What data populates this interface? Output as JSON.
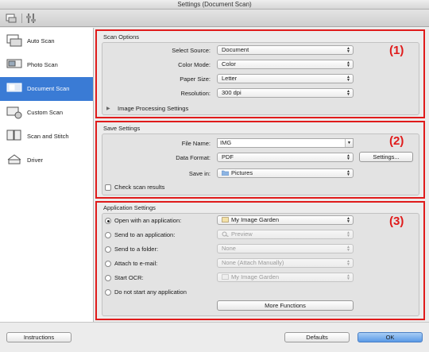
{
  "window": {
    "title": "Settings (Document Scan)"
  },
  "toolbar": {
    "icons": [
      "scan-from-computer-icon",
      "general-settings-icon"
    ]
  },
  "sidebar": {
    "items": [
      {
        "label": "Auto Scan",
        "icon": "auto-scan-icon",
        "selected": false
      },
      {
        "label": "Photo Scan",
        "icon": "photo-scan-icon",
        "selected": false
      },
      {
        "label": "Document Scan",
        "icon": "document-scan-icon",
        "selected": true
      },
      {
        "label": "Custom Scan",
        "icon": "custom-scan-icon",
        "selected": false
      },
      {
        "label": "Scan and Stitch",
        "icon": "scan-and-stitch-icon",
        "selected": false
      },
      {
        "label": "Driver",
        "icon": "driver-icon",
        "selected": false
      }
    ]
  },
  "scan_options": {
    "title": "Scan Options",
    "marker": "(1)",
    "select_source": {
      "label": "Select Source:",
      "value": "Document"
    },
    "color_mode": {
      "label": "Color Mode:",
      "value": "Color"
    },
    "paper_size": {
      "label": "Paper Size:",
      "value": "Letter"
    },
    "resolution": {
      "label": "Resolution:",
      "value": "300 dpi"
    },
    "image_processing": {
      "label": "Image Processing Settings"
    }
  },
  "save_settings": {
    "title": "Save Settings",
    "marker": "(2)",
    "file_name": {
      "label": "File Name:",
      "value": "IMG"
    },
    "data_format": {
      "label": "Data Format:",
      "value": "PDF"
    },
    "settings_button": "Settings...",
    "save_in": {
      "label": "Save in:",
      "value": "Pictures"
    },
    "check_results": {
      "label": "Check scan results",
      "checked": false
    }
  },
  "app_settings": {
    "title": "Application Settings",
    "marker": "(3)",
    "options": [
      {
        "label": "Open with an application:",
        "value": "My Image Garden",
        "selected": true,
        "enabled": true
      },
      {
        "label": "Send to an application:",
        "value": "Preview",
        "selected": false,
        "enabled": false
      },
      {
        "label": "Send to a folder:",
        "value": "None",
        "selected": false,
        "enabled": false
      },
      {
        "label": "Attach to e-mail:",
        "value": "None (Attach Manually)",
        "selected": false,
        "enabled": false
      },
      {
        "label": "Start OCR:",
        "value": "My Image Garden",
        "selected": false,
        "enabled": false
      },
      {
        "label": "Do not start any application",
        "selected": false
      }
    ],
    "more_functions": "More Functions"
  },
  "footer": {
    "instructions": "Instructions",
    "defaults": "Defaults",
    "ok": "OK"
  },
  "colors": {
    "selection": "#3a7bd5",
    "marker": "#e01b1b",
    "ok_button": "#5a9ae6"
  }
}
